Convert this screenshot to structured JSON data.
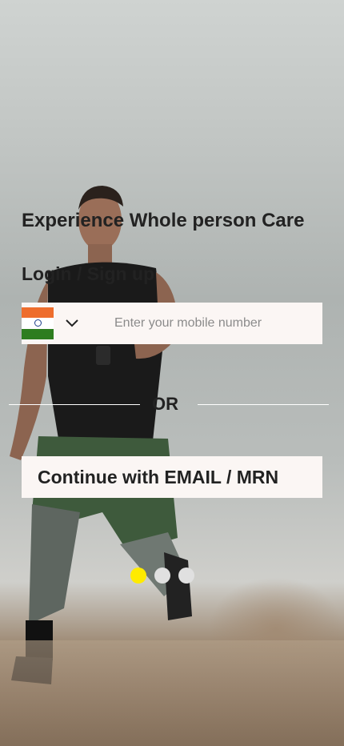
{
  "headline": "Experience Whole person Care",
  "login": {
    "title": "Login / Sign up",
    "country_code_flag": "india-flag-icon",
    "phone_placeholder": "Enter your mobile number"
  },
  "divider": {
    "text": "OR"
  },
  "email_button": {
    "label": "Continue with EMAIL / MRN"
  },
  "carousel": {
    "count": 3,
    "active_index": 0,
    "active_color": "#ffeb00",
    "inactive_color": "#e0e0e0"
  },
  "colors": {
    "field_bg": "#fbf6f4",
    "text": "#222222"
  }
}
